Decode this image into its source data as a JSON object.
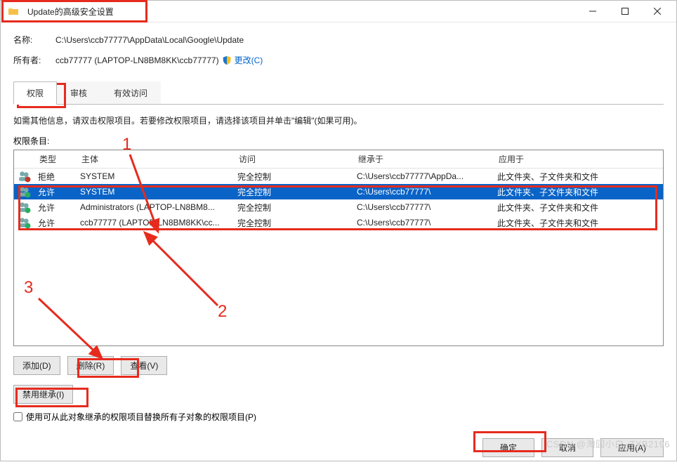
{
  "window": {
    "title": "Update的高级安全设置",
    "minimize_label": "Minimize",
    "maximize_label": "Maximize",
    "close_label": "Close"
  },
  "info": {
    "name_label": "名称:",
    "name_value": "C:\\Users\\ccb77777\\AppData\\Local\\Google\\Update",
    "owner_label": "所有者:",
    "owner_value": "ccb77777 (LAPTOP-LN8BM8KK\\ccb77777)",
    "change_link": "更改(C)"
  },
  "tabs": {
    "permissions": "权限",
    "auditing": "审核",
    "effective": "有效访问"
  },
  "help_text": "如需其他信息，请双击权限项目。若要修改权限项目，请选择该项目并单击\"编辑\"(如果可用)。",
  "entries_label": "权限条目:",
  "columns": {
    "type": "类型",
    "principal": "主体",
    "access": "访问",
    "inherited": "继承于",
    "applies": "应用于"
  },
  "rows": [
    {
      "type": "拒绝",
      "principal": "SYSTEM",
      "access": "完全控制",
      "inherited": "C:\\Users\\ccb77777\\AppDa...",
      "applies": "此文件夹、子文件夹和文件",
      "selected": false,
      "icon": "deny"
    },
    {
      "type": "允许",
      "principal": "SYSTEM",
      "access": "完全控制",
      "inherited": "C:\\Users\\ccb77777\\",
      "applies": "此文件夹、子文件夹和文件",
      "selected": true,
      "icon": "allow"
    },
    {
      "type": "允许",
      "principal": "Administrators (LAPTOP-LN8BM8...",
      "access": "完全控制",
      "inherited": "C:\\Users\\ccb77777\\",
      "applies": "此文件夹、子文件夹和文件",
      "selected": false,
      "icon": "allow"
    },
    {
      "type": "允许",
      "principal": "ccb77777 (LAPTOP-LN8BM8KK\\cc...",
      "access": "完全控制",
      "inherited": "C:\\Users\\ccb77777\\",
      "applies": "此文件夹、子文件夹和文件",
      "selected": false,
      "icon": "allow"
    }
  ],
  "buttons": {
    "add": "添加(D)",
    "remove": "删除(R)",
    "view": "查看(V)",
    "disable_inherit": "禁用继承(I)",
    "ok": "确定",
    "cancel": "取消",
    "apply": "应用(A)"
  },
  "replace_checkbox": "使用可从此对象继承的权限项目替换所有子对象的权限项目(P)",
  "annotations": {
    "n1": "1",
    "n2": "2",
    "n3": "3"
  },
  "watermark": "CSDN @淘囧小白_TXB2196"
}
